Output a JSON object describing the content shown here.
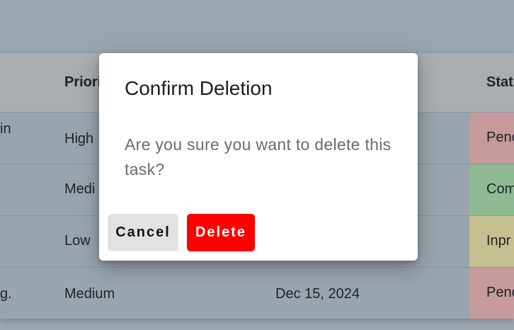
{
  "table": {
    "headers": {
      "priority": "Priori",
      "status": "Stat"
    },
    "rows": [
      {
        "task": "in",
        "priority": "High",
        "date": "",
        "status": "Penc",
        "status_color": "#c79a9e"
      },
      {
        "task": "",
        "priority": "Medi",
        "date": "",
        "status": "Com",
        "status_color": "#8fba92"
      },
      {
        "task": "",
        "priority": "Low",
        "date": "",
        "status": "Inpr",
        "status_color": "#c5c08f"
      },
      {
        "task": "g.",
        "priority": "Medium",
        "date": "Dec 15, 2024",
        "status": "Penc",
        "status_color": "#c79a9e"
      }
    ]
  },
  "dialog": {
    "title": "Confirm Deletion",
    "message": "Are you sure you want to delete this task?",
    "cancel_label": "Cancel",
    "delete_label": "Delete"
  },
  "colors": {
    "danger": "#ff0000",
    "neutral_button": "#e2e2e2",
    "backdrop": "#9ba5ae"
  }
}
